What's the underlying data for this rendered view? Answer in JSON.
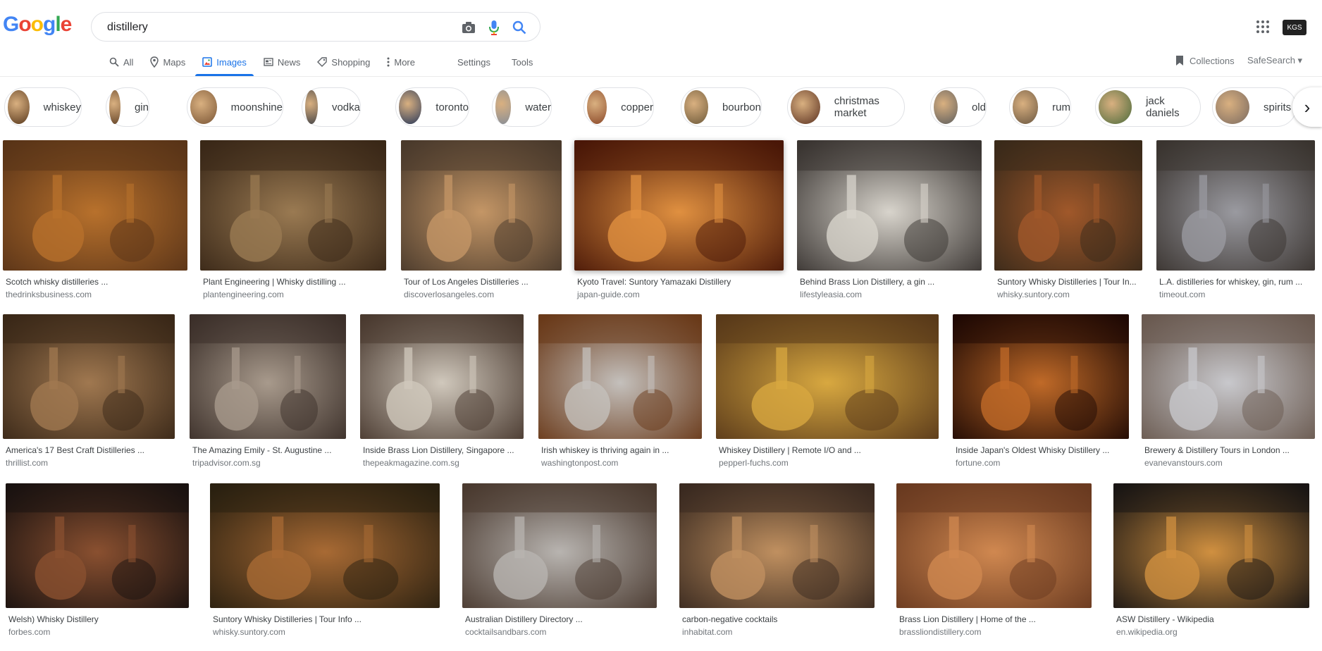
{
  "header": {
    "logo_letters": [
      {
        "ch": "G",
        "color": "#4285f4"
      },
      {
        "ch": "o",
        "color": "#ea4335"
      },
      {
        "ch": "o",
        "color": "#fbbc05"
      },
      {
        "ch": "g",
        "color": "#4285f4"
      },
      {
        "ch": "l",
        "color": "#34a853"
      },
      {
        "ch": "e",
        "color": "#ea4335"
      }
    ],
    "search_value": "distillery",
    "camera_icon": "camera-icon",
    "mic_icon": "microphone-icon",
    "search_icon": "search-icon",
    "apps_icon": "apps-grid-icon",
    "avatar_text": "KGS"
  },
  "tabs": [
    {
      "label": "All",
      "icon": "search-icon",
      "active": false
    },
    {
      "label": "Maps",
      "icon": "map-pin-icon",
      "active": false
    },
    {
      "label": "Images",
      "icon": "image-icon",
      "active": true
    },
    {
      "label": "News",
      "icon": "news-icon",
      "active": false
    },
    {
      "label": "Shopping",
      "icon": "tag-icon",
      "active": false
    },
    {
      "label": "More",
      "icon": "more-vert-icon",
      "active": false
    }
  ],
  "tools": {
    "settings": "Settings",
    "tools": "Tools"
  },
  "collections_label": "Collections",
  "safesearch_label": "SafeSearch ▾",
  "chips": [
    {
      "label": "whiskey",
      "color": "#5a3a1e"
    },
    {
      "label": "gin",
      "color": "#6b4a2c"
    },
    {
      "label": "moonshine",
      "color": "#7a5535"
    },
    {
      "label": "vodka",
      "color": "#4d4a4a"
    },
    {
      "label": "toronto",
      "color": "#2b3a5a"
    },
    {
      "label": "water",
      "color": "#8a8f96"
    },
    {
      "label": "copper",
      "color": "#8c4a2a"
    },
    {
      "label": "bourbon",
      "color": "#6e5a3a"
    },
    {
      "label": "christmas market",
      "color": "#5a3020"
    },
    {
      "label": "old",
      "color": "#5e5e5e"
    },
    {
      "label": "rum",
      "color": "#6a5640"
    },
    {
      "label": "jack daniels",
      "color": "#4a6a3a"
    },
    {
      "label": "spirits",
      "color": "#7a6a60"
    }
  ],
  "results": [
    {
      "title": "Scotch whisky distilleries ...",
      "site": "thedrinksbusiness.com",
      "c1": "#b8712c",
      "c2": "#5a3418"
    },
    {
      "title": "Plant Engineering | Whisky distilling ...",
      "site": "plantengineering.com",
      "c1": "#9a7a52",
      "c2": "#3a2818"
    },
    {
      "title": "Tour of Los Angeles Distilleries ...",
      "site": "discoverlosangeles.com",
      "c1": "#c49666",
      "c2": "#4a3a2c"
    },
    {
      "title": "Kyoto Travel: Suntory Yamazaki Distillery",
      "site": "japan-guide.com",
      "c1": "#e09040",
      "c2": "#4a1808"
    },
    {
      "title": "Behind Brass Lion Distillery, a gin ...",
      "site": "lifestyleasia.com",
      "c1": "#d8d4cc",
      "c2": "#3a3532"
    },
    {
      "title": "Suntory Whisky Distilleries | Tour In...",
      "site": "whisky.suntory.com",
      "c1": "#a0582a",
      "c2": "#3a2a1a"
    },
    {
      "title": "L.A. distilleries for whiskey, gin, rum ...",
      "site": "timeout.com",
      "c1": "#9a9aa0",
      "c2": "#3a3430"
    },
    {
      "title": "America's 17 Best Craft Distilleries ...",
      "site": "thrillist.com",
      "c1": "#a07850",
      "c2": "#3a2818"
    },
    {
      "title": "The Amazing Emily - St. Augustine ...",
      "site": "tripadvisor.com.sg",
      "c1": "#a89a8c",
      "c2": "#3c302a"
    },
    {
      "title": "Inside Brass Lion Distillery, Singapore ...",
      "site": "thepeakmagazine.com.sg",
      "c1": "#d0c8bc",
      "c2": "#4a3a30"
    },
    {
      "title": "Irish whiskey is thriving again in ...",
      "site": "washingtonpost.com",
      "c1": "#c4c0bc",
      "c2": "#6a3a1a"
    },
    {
      "title": "Whiskey Distillery | Remote I/O and ...",
      "site": "pepperl-fuchs.com",
      "c1": "#d8a840",
      "c2": "#5a3a1a"
    },
    {
      "title": "Inside Japan's Oldest Whisky Distillery ...",
      "site": "fortune.com",
      "c1": "#c06a28",
      "c2": "#200a04"
    },
    {
      "title": "Brewery & Distillery Tours in London ...",
      "site": "evanevanstours.com",
      "c1": "#c8c8cc",
      "c2": "#6a5a50"
    },
    {
      "title": "Welsh) Whisky Distillery",
      "site": "forbes.com",
      "c1": "#8a5030",
      "c2": "#1a1210"
    },
    {
      "title": "Suntory Whisky Distilleries | Tour Info ...",
      "site": "whisky.suntory.com",
      "c1": "#a86a34",
      "c2": "#2a2010"
    },
    {
      "title": "Australian Distillery Directory ...",
      "site": "cocktailsandbars.com",
      "c1": "#b8b4b0",
      "c2": "#4a3a30"
    },
    {
      "title": "carbon-negative cocktails",
      "site": "inhabitat.com",
      "c1": "#c09060",
      "c2": "#3a2a20"
    },
    {
      "title": "Brass Lion Distillery | Home of the ...",
      "site": "brassliondistillery.com",
      "c1": "#d08850",
      "c2": "#6a3a20"
    },
    {
      "title": "ASW Distillery - Wikipedia",
      "site": "en.wikipedia.org",
      "c1": "#d09040",
      "c2": "#1a1614"
    }
  ]
}
